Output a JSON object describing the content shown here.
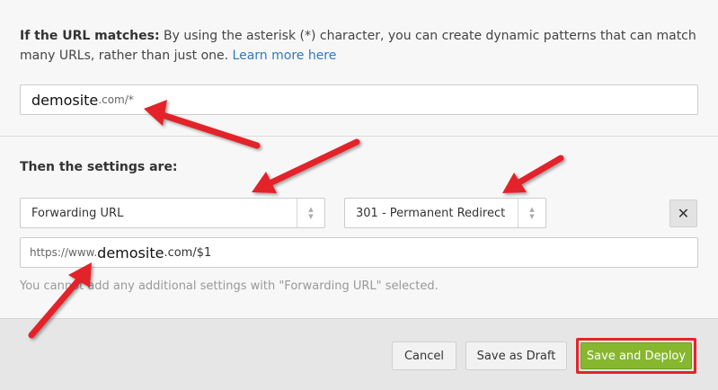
{
  "match": {
    "label": "If the URL matches:",
    "description": " By using the asterisk (*) character, you can create dynamic patterns that can match many URLs, rather than just one. ",
    "link": "Learn more here",
    "url_value_domain": "demosite",
    "url_value_rest": ".com/*"
  },
  "settings": {
    "heading": "Then the settings are:",
    "setting_select": "Forwarding URL",
    "status_select": "301 - Permanent Redirect",
    "remove_symbol": "✕",
    "forward_prefix": "https://www.",
    "forward_domain": " demosite",
    "forward_rest": ".com/$1",
    "hint": "You cannot add any additional settings with \"Forwarding URL\" selected."
  },
  "footer": {
    "cancel": "Cancel",
    "draft": "Save as Draft",
    "deploy": "Save and Deploy"
  },
  "colors": {
    "annotation_arrow": "#e3242b",
    "deploy_button": "#86b72e",
    "link": "#2e7bbf"
  },
  "icons": {
    "select_arrows": "up-down-chevron-icon",
    "remove": "close-icon",
    "annotation": "red-arrow-icon"
  }
}
